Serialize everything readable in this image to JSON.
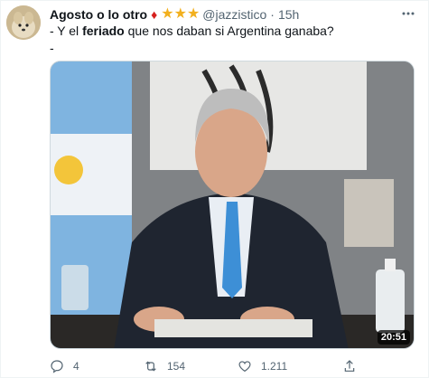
{
  "tweet": {
    "author_name": "Agosto o lo otro",
    "badges": [
      "diamond-icon",
      "star-icon",
      "star-icon",
      "star-icon"
    ],
    "handle": "@jazzistico",
    "separator": "·",
    "time": "15h",
    "text_prefix": "- Y el ",
    "text_bold": "feriado",
    "text_suffix": " que nos daban si Argentina ganaba?",
    "text_line2": "-",
    "media": {
      "video_duration": "20:51"
    },
    "actions": {
      "replies": "4",
      "retweets": "154",
      "likes": "1.211"
    }
  },
  "colors": {
    "text": "#0f1419",
    "secondary": "#536471",
    "diamond": "#d6211e",
    "star": "#f2b01e",
    "border": "#cfd9de"
  }
}
